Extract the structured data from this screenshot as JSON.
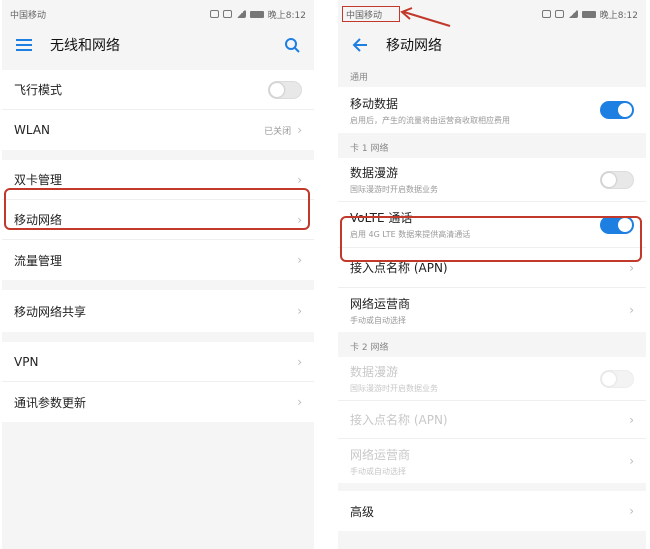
{
  "left": {
    "status": {
      "carrier": "中国移动",
      "time": "晚上8:12"
    },
    "title": "无线和网络",
    "items": [
      {
        "label": "飞行模式",
        "toggle": "off"
      },
      {
        "label": "WLAN",
        "value": "已关闭"
      },
      {
        "label": "双卡管理"
      },
      {
        "label": "移动网络"
      },
      {
        "label": "流量管理"
      },
      {
        "label": "移动网络共享"
      },
      {
        "label": "VPN"
      },
      {
        "label": "通讯参数更新"
      }
    ]
  },
  "right": {
    "status": {
      "carrier": "中国移动",
      "time": "晚上8:12"
    },
    "title": "移动网络",
    "sections": {
      "general": "通用",
      "card1": "卡 1 网络",
      "card2": "卡 2 网络"
    },
    "general": {
      "mobile_data": {
        "label": "移动数据",
        "sub": "启用后，产生的流量将由运营商收取相应费用",
        "toggle": "on"
      }
    },
    "card1": {
      "roaming": {
        "label": "数据漫游",
        "sub": "国际漫游时开启数据业务",
        "toggle": "off"
      },
      "volte": {
        "label": "VoLTE 通话",
        "sub": "启用 4G LTE 数据来提供高清通话",
        "toggle": "on"
      },
      "apn": {
        "label": "接入点名称 (APN)"
      },
      "operator": {
        "label": "网络运营商",
        "sub": "手动或自动选择"
      }
    },
    "card2": {
      "roaming": {
        "label": "数据漫游",
        "sub": "国际漫游时开启数据业务",
        "toggle": "off"
      },
      "apn": {
        "label": "接入点名称 (APN)"
      },
      "operator": {
        "label": "网络运营商",
        "sub": "手动或自动选择"
      }
    },
    "advanced": {
      "label": "高级"
    }
  },
  "colors": {
    "accent": "#1e7fe3",
    "annotation": "#c0392b"
  }
}
